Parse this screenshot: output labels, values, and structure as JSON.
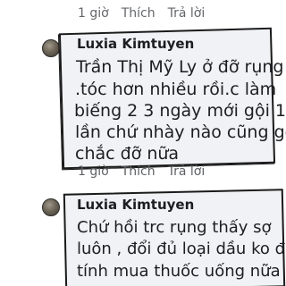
{
  "comment_top_meta": {
    "time": "1 giờ",
    "like": "Thích",
    "reply": "Trả lời"
  },
  "comment_1": {
    "author": "Luxia Kimtuyen",
    "mention": "Trần Thị Mỹ Ly",
    "lines": [
      "Trần Thị Mỹ Ly ở đỡ rụng",
      ".tóc hơn nhiều rồi.c làm",
      "biếng 2 3 ngày mới gội 1",
      "lần chứ nhày nào cũng gội",
      "chắc đỡ nữa"
    ],
    "meta": {
      "time": "1 giờ",
      "like": "Thích",
      "reply": "Trả lời"
    }
  },
  "comment_2": {
    "author": "Luxia Kimtuyen",
    "lines": [
      "Chứ hồi trc rụng thấy sợ",
      "luôn , đổi đủ loại dầu ko đỡ",
      "tính mua thuốc uống nữa"
    ]
  },
  "colors": {
    "bubble_bg": "#f0f2f5",
    "text": "#1c1e21",
    "meta": "#65676b",
    "annotation": "#1a1a1a"
  }
}
